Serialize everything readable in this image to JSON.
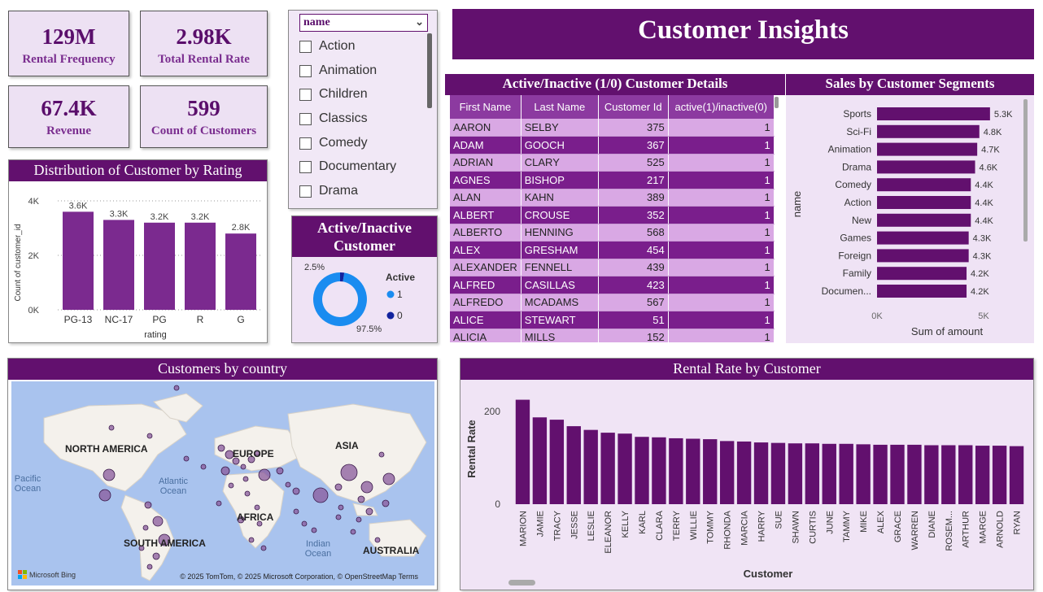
{
  "kpis": [
    {
      "value": "129M",
      "label": "Rental Frequency"
    },
    {
      "value": "2.98K",
      "label": "Total Rental Rate"
    },
    {
      "value": "67.4K",
      "label": "Revenue"
    },
    {
      "value": "599",
      "label": "Count of Customers"
    }
  ],
  "slicer": {
    "header": "name",
    "items": [
      "Action",
      "Animation",
      "Children",
      "Classics",
      "Comedy",
      "Documentary",
      "Drama"
    ]
  },
  "banner": {
    "title": "Customer Insights"
  },
  "rating_chart": {
    "title": "Distribution of Customer by Rating",
    "chart_data": {
      "type": "bar",
      "categories": [
        "PG-13",
        "NC-17",
        "PG",
        "R",
        "G"
      ],
      "values": [
        3.6,
        3.3,
        3.2,
        3.2,
        2.8
      ],
      "data_labels": [
        "3.6K",
        "3.3K",
        "3.2K",
        "3.2K",
        "2.8K"
      ],
      "xlabel": "rating",
      "ylabel": "Count of customer_id",
      "yticks": [
        "0K",
        "2K",
        "4K"
      ],
      "ylim": [
        0,
        4
      ],
      "color": "#7b2a8f"
    }
  },
  "active_chart": {
    "title_line1": "Active/Inactive",
    "title_line2": "Customer",
    "chart_data": {
      "type": "pie",
      "legend_title": "Active",
      "slices": [
        {
          "name": "1",
          "value": 97.5,
          "label": "97.5%",
          "color": "#1a8cf0"
        },
        {
          "name": "0",
          "value": 2.5,
          "label": "2.5%",
          "color": "#12239e"
        }
      ]
    }
  },
  "customer_table": {
    "title": "Active/Inactive (1/0) Customer Details",
    "columns": [
      "First Name",
      "Last Name",
      "Customer Id",
      "active(1)/inactive(0)"
    ],
    "rows": [
      [
        "AARON",
        "SELBY",
        "375",
        "1"
      ],
      [
        "ADAM",
        "GOOCH",
        "367",
        "1"
      ],
      [
        "ADRIAN",
        "CLARY",
        "525",
        "1"
      ],
      [
        "AGNES",
        "BISHOP",
        "217",
        "1"
      ],
      [
        "ALAN",
        "KAHN",
        "389",
        "1"
      ],
      [
        "ALBERT",
        "CROUSE",
        "352",
        "1"
      ],
      [
        "ALBERTO",
        "HENNING",
        "568",
        "1"
      ],
      [
        "ALEX",
        "GRESHAM",
        "454",
        "1"
      ],
      [
        "ALEXANDER",
        "FENNELL",
        "439",
        "1"
      ],
      [
        "ALFRED",
        "CASILLAS",
        "423",
        "1"
      ],
      [
        "ALFREDO",
        "MCADAMS",
        "567",
        "1"
      ],
      [
        "ALICE",
        "STEWART",
        "51",
        "1"
      ],
      [
        "ALICIA",
        "MILLS",
        "152",
        "1"
      ]
    ]
  },
  "segments_chart": {
    "title": "Sales by Customer Segments",
    "chart_data": {
      "type": "bar",
      "orientation": "horizontal",
      "categories": [
        "Sports",
        "Sci-Fi",
        "Animation",
        "Drama",
        "Comedy",
        "Action",
        "New",
        "Games",
        "Foreign",
        "Family",
        "Documen..."
      ],
      "values": [
        5.3,
        4.8,
        4.7,
        4.6,
        4.4,
        4.4,
        4.4,
        4.3,
        4.3,
        4.2,
        4.2
      ],
      "data_labels": [
        "5.3K",
        "4.8K",
        "4.7K",
        "4.6K",
        "4.4K",
        "4.4K",
        "4.4K",
        "4.3K",
        "4.3K",
        "4.2K",
        "4.2K"
      ],
      "xlabel": "Sum of amount",
      "ylabel": "name",
      "xticks": [
        "0K",
        "5K"
      ],
      "xlim": [
        0,
        5
      ],
      "color": "#62106e"
    }
  },
  "map": {
    "title": "Customers by country",
    "labels": {
      "north_america": "NORTH AMERICA",
      "europe": "EUROPE",
      "asia": "ASIA",
      "africa": "AFRICA",
      "south_america": "SOUTH AMERICA",
      "australia": "AUSTRALIA",
      "pacific": "Pacific Ocean",
      "atlantic": "Atlantic Ocean",
      "indian": "Indian Ocean"
    },
    "brand": "Microsoft Bing",
    "attribution": "© 2025 TomTom, © 2025 Microsoft Corporation, © OpenStreetMap  Terms"
  },
  "rental_chart": {
    "title": "Rental Rate by Customer",
    "chart_data": {
      "type": "bar",
      "categories": [
        "MARION",
        "JAMIE",
        "TRACY",
        "JESSE",
        "LESLIE",
        "ELEANOR",
        "KELLY",
        "KARL",
        "CLARA",
        "TERRY",
        "WILLIE",
        "TOMMY",
        "RHONDA",
        "MARCIA",
        "HARRY",
        "SUE",
        "SHAWN",
        "CURTIS",
        "JUNE",
        "TAMMY",
        "MIKE",
        "ALEX",
        "GRACE",
        "WARREN",
        "DIANE",
        "ROSEM...",
        "ARTHUR",
        "MARGE",
        "ARNOLD",
        "RYAN"
      ],
      "values": [
        225,
        187,
        182,
        168,
        160,
        154,
        152,
        145,
        144,
        142,
        141,
        140,
        136,
        135,
        133,
        132,
        131,
        131,
        130,
        130,
        129,
        128,
        128,
        128,
        127,
        127,
        127,
        126,
        126,
        125
      ],
      "xlabel": "Customer",
      "ylabel": "Rental Rate",
      "yticks": [
        "0",
        "200"
      ],
      "ylim": [
        0,
        240
      ],
      "color": "#62106e"
    }
  }
}
